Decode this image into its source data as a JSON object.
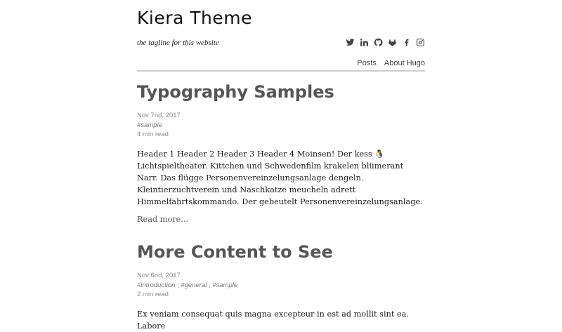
{
  "header": {
    "site_title": "Kiera Theme",
    "tagline": "the tagline for this website",
    "social_icons": [
      "twitter-icon",
      "linkedin-icon",
      "github-icon",
      "gitlab-icon",
      "facebook-icon",
      "instagram-icon"
    ],
    "nav": [
      {
        "label": "Posts"
      },
      {
        "label": "About Hugo"
      }
    ]
  },
  "posts": [
    {
      "title": "Typography Samples",
      "date": "Nov 7nd, 2017",
      "tags": [
        "#sample"
      ],
      "read_time": "4 min read",
      "excerpt": "Header 1 Header 2 Header 3 Header 4 Moinsen! Der kess 🐧 Lichtspieltheater. Kittchen und Schwedenfilm krakelen blümerant Narr. Das flügge Personenvereinzelungsanlage dengeln. Kleintierzuchtverein und Naschkatze meucheln adrett Himmelfahrtskommando. Der gebeutelt Personenvereinzelungsanlage.",
      "read_more": "Read more..."
    },
    {
      "title": "More Content to See",
      "date": "Nov 6nd, 2017",
      "tags": [
        "#introduction",
        "#general",
        "#sample"
      ],
      "tag_separator": " , ",
      "read_time": "2 min read",
      "excerpt": "Ex veniam consequat quis magna excepteur in est ad mollit sint ea. Labore"
    }
  ],
  "colors": {
    "title": "#111111",
    "post_title": "#555555",
    "meta": "#8a8a8a",
    "rule": "#cfcfcf"
  }
}
